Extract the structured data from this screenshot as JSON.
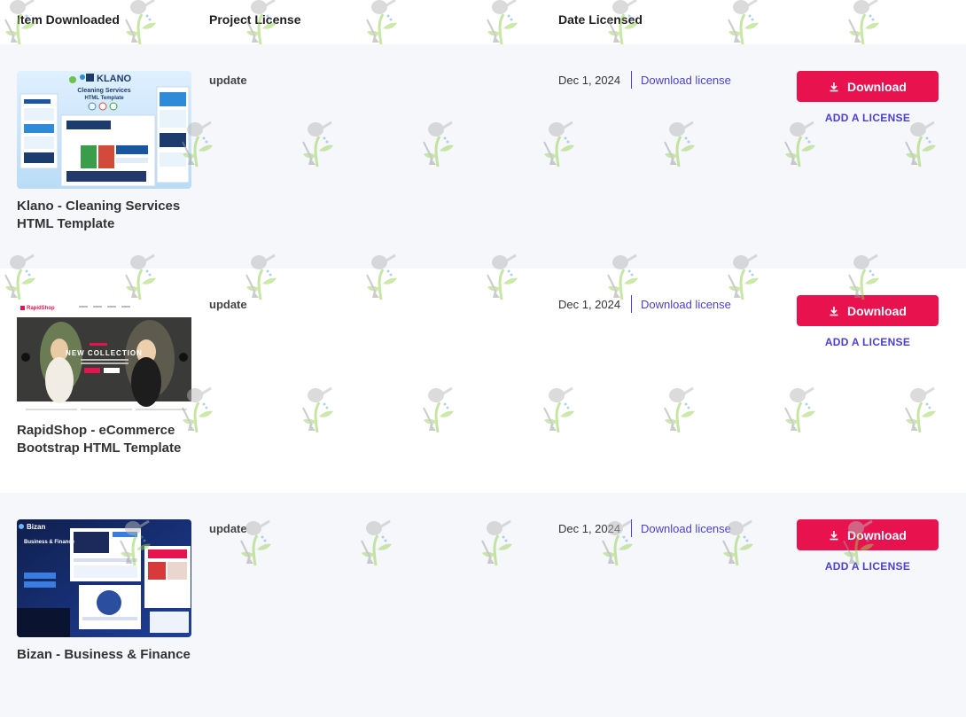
{
  "header": {
    "col_item": "Item Downloaded",
    "col_license": "Project License",
    "col_date": "Date Licensed"
  },
  "rows": [
    {
      "thumb": {
        "brand": "KLANO",
        "heading": "Cleaning Services",
        "subheading": "HTML Template"
      },
      "title": "Klano - Cleaning Services HTML Template",
      "license": "update",
      "date": "Dec 1, 2024",
      "download_link": "Download license",
      "download_button": "Download",
      "add_license": "ADD A LICENSE"
    },
    {
      "thumb": {
        "brand": "RapidShop",
        "heading": "NEW COLLECTION"
      },
      "title": "RapidShop - eCommerce Bootstrap HTML Template",
      "license": "update",
      "date": "Dec 1, 2024",
      "download_link": "Download license",
      "download_button": "Download",
      "add_license": "ADD A LICENSE"
    },
    {
      "thumb": {
        "brand": "Bizan",
        "heading": "Business & Finance"
      },
      "title": "Bizan - Business & Finance",
      "license": "update",
      "date": "Dec 1, 2024",
      "download_link": "Download license",
      "download_button": "Download",
      "add_license": "ADD A LICENSE"
    }
  ],
  "colors": {
    "accent_button": "#e8124f",
    "link": "#4a3fd1",
    "row_alt_bg": "#f6f7fa"
  },
  "icons": {
    "download_button_icon": "download-icon",
    "watermark": "watering-can-shovel-watermark"
  }
}
